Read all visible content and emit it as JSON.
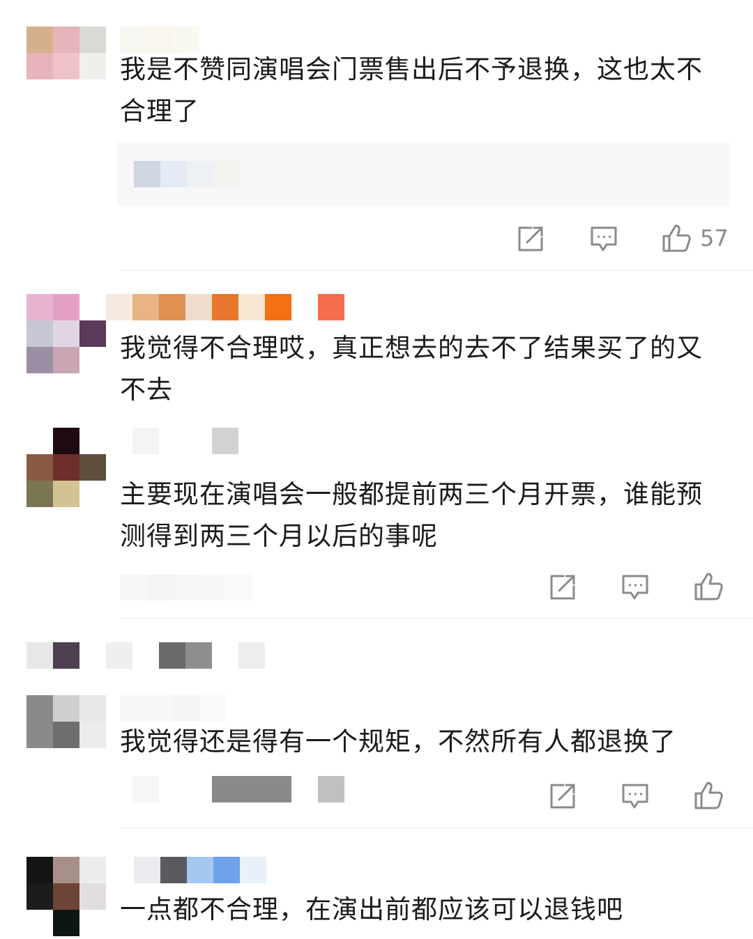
{
  "comments": [
    {
      "text": "我是不赞同演唱会门票售出后不予退换，这也太不合理了",
      "likes": "57"
    },
    {
      "text": "我觉得不合理哎，真正想去的去不了结果买了的又不去"
    },
    {
      "text": "主要现在演唱会一般都提前两三个月开票，谁能预测得到两三个月以后的事呢"
    },
    {
      "text": "我觉得还是得有一个规矩，不然所有人都退换了"
    },
    {
      "text": "一点都不合理，在演出前都应该可以退钱吧"
    }
  ],
  "icons": {
    "share": "share-icon",
    "comment": "comment-icon",
    "like": "thumbs-up-icon"
  },
  "colors": {
    "text": "#1a1a1a",
    "icon": "#8a8a8a",
    "reply_bg": "#f7f7f7",
    "divider": "#ececec"
  }
}
